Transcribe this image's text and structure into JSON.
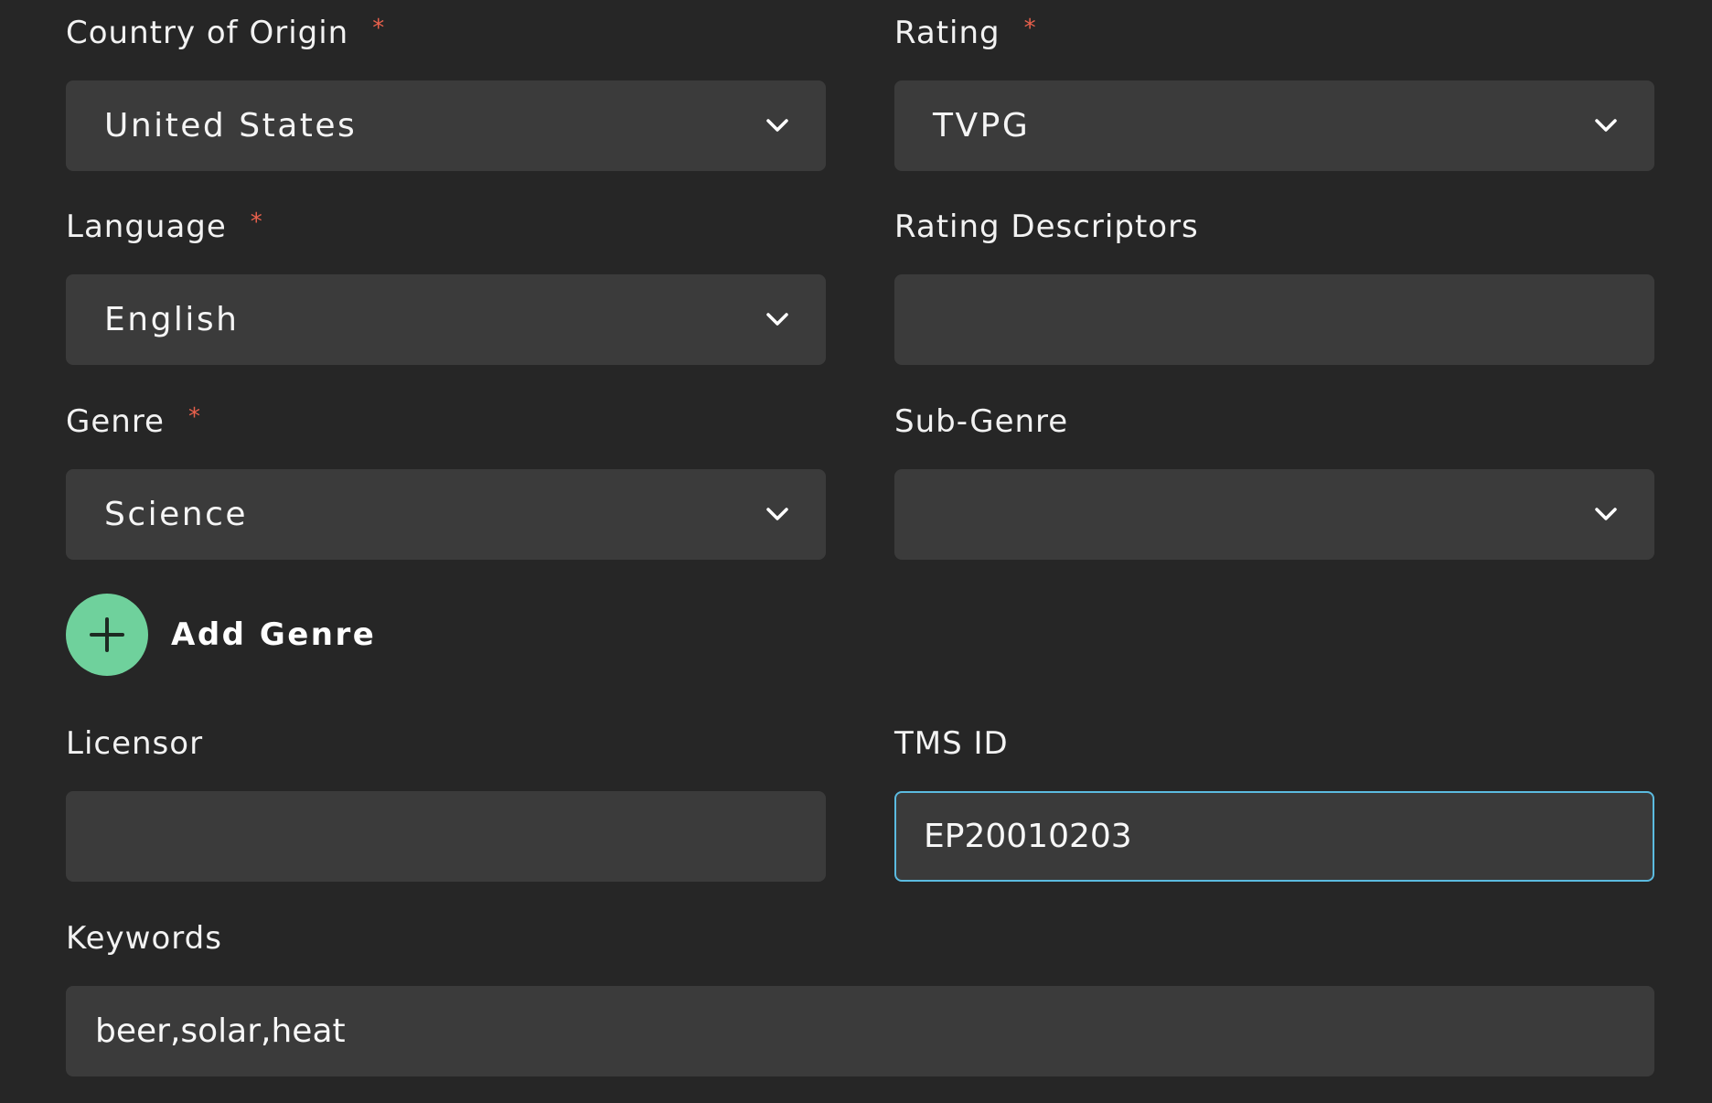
{
  "fields": {
    "country_of_origin": {
      "label": "Country of Origin",
      "required_mark": "*",
      "value": "United States"
    },
    "rating": {
      "label": "Rating",
      "required_mark": "*",
      "value": "TVPG"
    },
    "language": {
      "label": "Language",
      "required_mark": "*",
      "value": "English"
    },
    "rating_descriptors": {
      "label": "Rating Descriptors",
      "value": ""
    },
    "genre": {
      "label": "Genre",
      "required_mark": "*",
      "value": "Science"
    },
    "sub_genre": {
      "label": "Sub-Genre",
      "value": ""
    },
    "licensor": {
      "label": "Licensor",
      "value": ""
    },
    "tms_id": {
      "label": "TMS ID",
      "value": "EP20010203"
    },
    "keywords": {
      "label": "Keywords",
      "value": "beer,solar,heat"
    }
  },
  "add_genre": {
    "label": "Add Genre",
    "icon": "plus-icon"
  },
  "colors": {
    "background": "#262626",
    "field_background": "#3b3b3b",
    "required": "#e8604c",
    "accent_green": "#6fd19c",
    "focus_border": "#5bbbe0"
  }
}
